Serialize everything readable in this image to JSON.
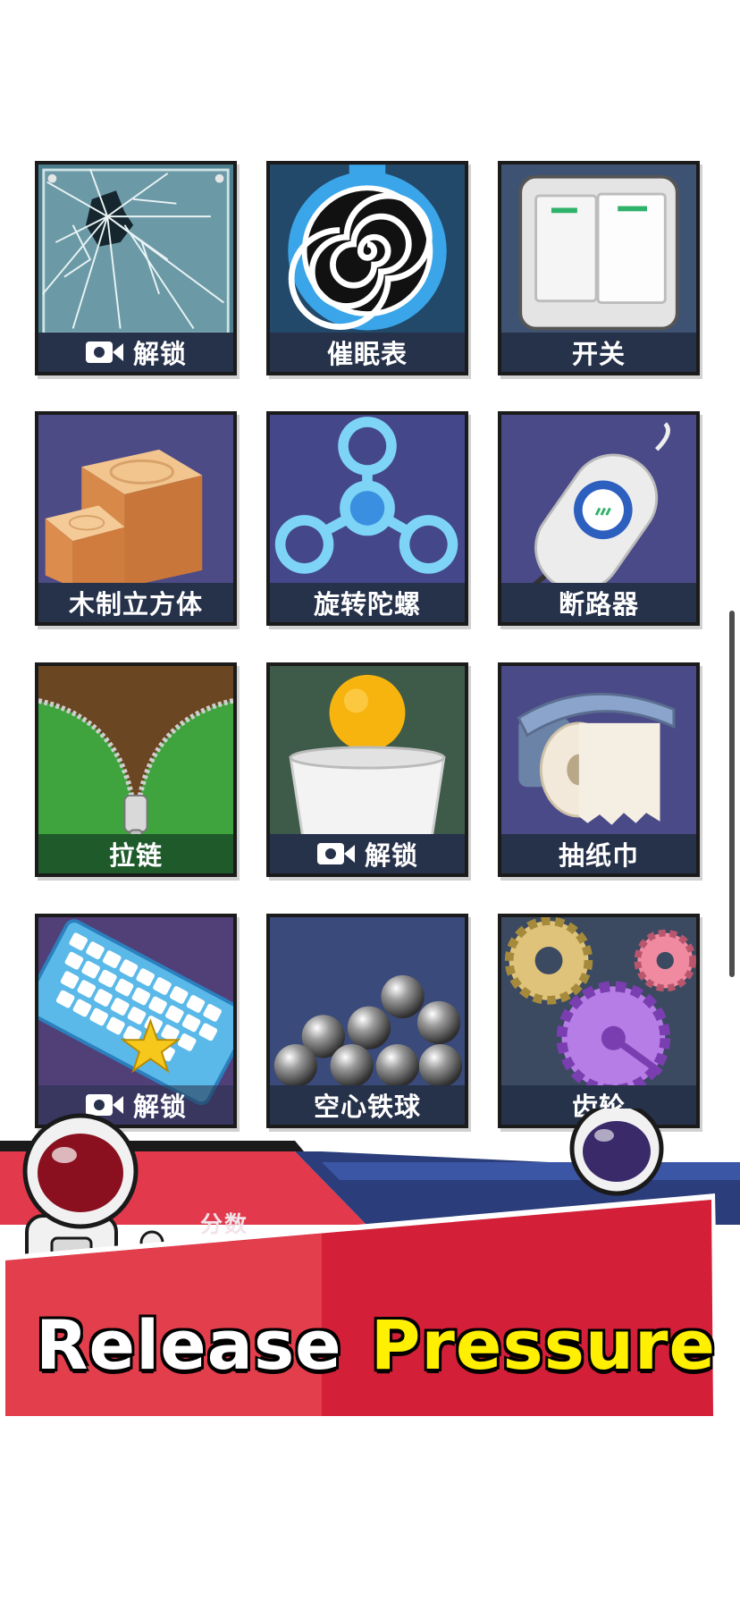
{
  "tiles": [
    {
      "label": "解锁",
      "locked": true,
      "art": "broken-glass"
    },
    {
      "label": "催眠表",
      "locked": false,
      "art": "hypnosis-watch"
    },
    {
      "label": "开关",
      "locked": false,
      "art": "light-switch"
    },
    {
      "label": "木制立方体",
      "locked": false,
      "art": "wood-cubes"
    },
    {
      "label": "旋转陀螺",
      "locked": false,
      "art": "fidget-spinner"
    },
    {
      "label": "断路器",
      "locked": false,
      "art": "breaker"
    },
    {
      "label": "拉链",
      "locked": false,
      "art": "zipper"
    },
    {
      "label": "解锁",
      "locked": true,
      "art": "ping-pong-cup"
    },
    {
      "label": "抽纸巾",
      "locked": false,
      "art": "toilet-paper"
    },
    {
      "label": "解锁",
      "locked": true,
      "art": "keyboard"
    },
    {
      "label": "空心铁球",
      "locked": false,
      "art": "steel-balls"
    },
    {
      "label": "齿轮",
      "locked": false,
      "art": "gears"
    }
  ],
  "banner": {
    "score_label": "分数",
    "title_white": "Release",
    "title_yellow": "Pressure"
  },
  "colors": {
    "tile_border": "#1b1b1b",
    "label_bar": "#26314a",
    "banner_red": "#d31f37",
    "title_yellow": "#ffef00"
  }
}
